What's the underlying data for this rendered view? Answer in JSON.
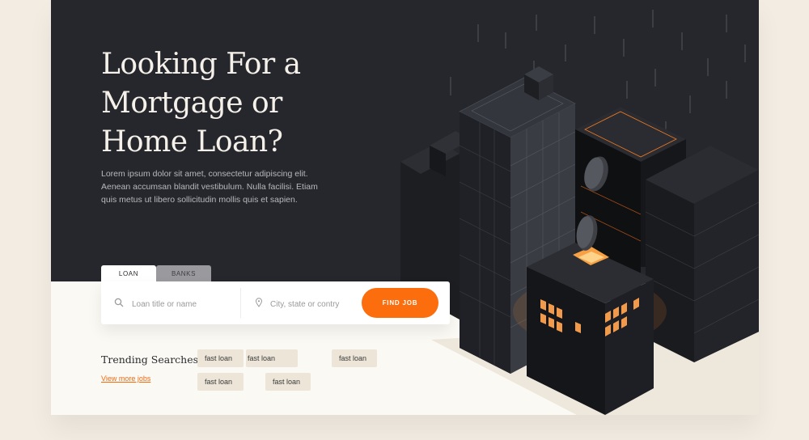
{
  "hero": {
    "title": "Looking For a Mortgage or Home Loan?",
    "description": "Lorem ipsum dolor sit amet, consectetur adipiscing elit. Aenean accumsan blandit vestibulum. Nulla facilisi. Etiam quis metus ut libero sollicitudin mollis quis et sapien."
  },
  "search": {
    "tabs": [
      "LOAN",
      "BANKS"
    ],
    "active_tab": "LOAN",
    "query_placeholder": "Loan title or name",
    "location_placeholder": "City, state or contry",
    "button_label": "FIND JOB"
  },
  "trending": {
    "title": "Trending Searches",
    "view_more": "View more jobs",
    "chips": [
      "fast loan",
      "fast loan",
      "fast loan",
      "fast loan",
      "fast loan"
    ]
  },
  "colors": {
    "accent": "#fb6d0d",
    "hero_bg": "#25272c",
    "page_bg": "#fbf9f4"
  },
  "icons": [
    "search-icon",
    "location-pin-icon"
  ]
}
